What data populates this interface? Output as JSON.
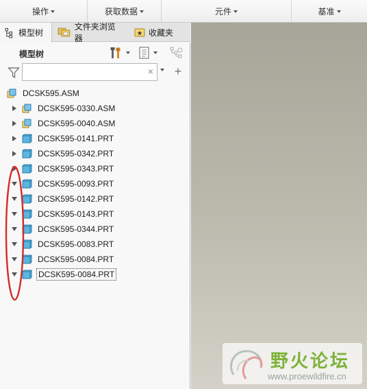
{
  "ribbon": {
    "groups": [
      {
        "label": "操作"
      },
      {
        "label": "获取数据"
      },
      {
        "label": "元件"
      },
      {
        "label": "基准"
      }
    ]
  },
  "navigator": {
    "tabs": [
      {
        "label": "模型树",
        "icon": "tree-icon"
      },
      {
        "label": "文件夹浏览器",
        "icon": "folder-browser-icon"
      },
      {
        "label": "收藏夹",
        "icon": "favorites-icon"
      }
    ]
  },
  "panel": {
    "title": "模型树",
    "search": {
      "value": "",
      "placeholder": ""
    }
  },
  "tree": {
    "root": {
      "label": "DCSK595.ASM",
      "type": "asm"
    },
    "items": [
      {
        "label": "DCSK595-0330.ASM",
        "type": "asm",
        "state": "collapsed"
      },
      {
        "label": "DCSK595-0040.ASM",
        "type": "asm",
        "state": "collapsed"
      },
      {
        "label": "DCSK595-0141.PRT",
        "type": "prt",
        "state": "collapsed"
      },
      {
        "label": "DCSK595-0342.PRT",
        "type": "prt",
        "state": "collapsed"
      },
      {
        "label": "DCSK595-0343.PRT",
        "type": "prt",
        "state": "collapsed"
      },
      {
        "label": "DCSK595-0093.PRT",
        "type": "prt",
        "state": "expanded"
      },
      {
        "label": "DCSK595-0142.PRT",
        "type": "prt",
        "state": "expanded"
      },
      {
        "label": "DCSK595-0143.PRT",
        "type": "prt",
        "state": "expanded"
      },
      {
        "label": "DCSK595-0344.PRT",
        "type": "prt",
        "state": "expanded"
      },
      {
        "label": "DCSK595-0083.PRT",
        "type": "prt",
        "state": "expanded"
      },
      {
        "label": "DCSK595-0084.PRT",
        "type": "prt",
        "state": "expanded"
      },
      {
        "label": "DCSK595-0084.PRT",
        "type": "prt",
        "state": "expanded",
        "selected": true
      }
    ]
  },
  "watermark": {
    "title": "野火论坛",
    "url": "www.proewildfire.cn"
  },
  "colors": {
    "annotation_ring": "#d42a2a",
    "part_icon": "#4aa9d8",
    "assembly_icon": "#e0b94a",
    "watermark_green": "#7db23a"
  }
}
